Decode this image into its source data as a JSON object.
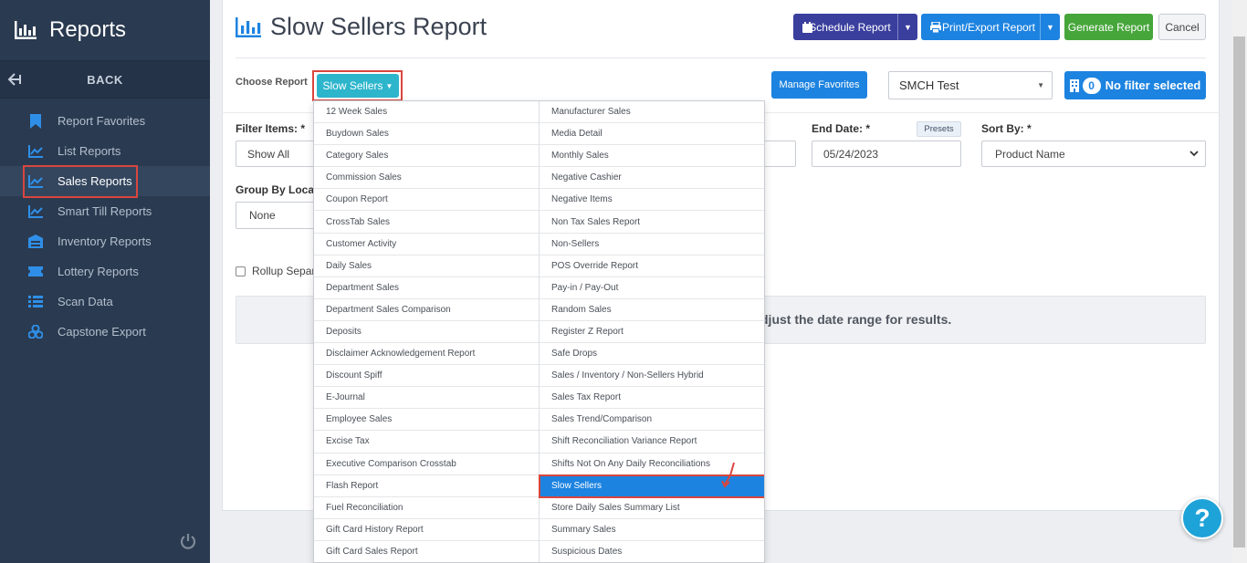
{
  "sidebar": {
    "title": "Reports",
    "back": "BACK",
    "items": [
      {
        "label": "Report Favorites",
        "icon": "bookmark-icon"
      },
      {
        "label": "List Reports",
        "icon": "line-chart-icon"
      },
      {
        "label": "Sales Reports",
        "icon": "line-chart-icon",
        "active": true
      },
      {
        "label": "Smart Till Reports",
        "icon": "line-chart-icon"
      },
      {
        "label": "Inventory Reports",
        "icon": "warehouse-icon"
      },
      {
        "label": "Lottery Reports",
        "icon": "ticket-icon"
      },
      {
        "label": "Scan Data",
        "icon": "list-icon"
      },
      {
        "label": "Capstone Export",
        "icon": "cubes-icon"
      }
    ]
  },
  "header": {
    "title": "Slow Sellers Report",
    "schedule_label": "Schedule Report",
    "print_label": "Print/Export Report",
    "generate_label": "Generate Report",
    "cancel_label": "Cancel"
  },
  "controls": {
    "choose_label": "Choose Report",
    "report_button": "Slow Sellers",
    "favorites_label": "Manage Favorites",
    "store": "SMCH Test",
    "filter_count": "0",
    "filter_label": "No filter selected"
  },
  "form": {
    "filter_items_label": "Filter Items: *",
    "filter_items_value": "Show All",
    "end_date_label": "End Date: *",
    "presets_label": "Presets",
    "end_date_value": "05/24/2023",
    "sort_by_label": "Sort By: *",
    "sort_by_value": "Product Name",
    "group_by_label": "Group By Locatio",
    "group_by_value": "None",
    "rollup_label": "Rollup Separa",
    "message": "djust the date range for results."
  },
  "menu": {
    "left": [
      "12 Week Sales",
      "Buydown Sales",
      "Category Sales",
      "Commission Sales",
      "Coupon Report",
      "CrossTab Sales",
      "Customer Activity",
      "Daily Sales",
      "Department Sales",
      "Department Sales Comparison",
      "Deposits",
      "Disclaimer Acknowledgement Report",
      "Discount Spiff",
      "E-Journal",
      "Employee Sales",
      "Excise Tax",
      "Executive Comparison Crosstab",
      "Flash Report",
      "Fuel Reconciliation",
      "Gift Card History Report",
      "Gift Card Sales Report"
    ],
    "right": [
      "Manufacturer Sales",
      "Media Detail",
      "Monthly Sales",
      "Negative Cashier",
      "Negative Items",
      "Non Tax Sales Report",
      "Non-Sellers",
      "POS Override Report",
      "Pay-in / Pay-Out",
      "Random Sales",
      "Register Z Report",
      "Safe Drops",
      "Sales / Inventory / Non-Sellers Hybrid",
      "Sales Tax Report",
      "Sales Trend/Comparison",
      "Shift Reconciliation Variance Report",
      "Shifts Not On Any Daily Reconciliations",
      "Slow Sellers",
      "Store Daily Sales Summary List",
      "Summary Sales",
      "Suspicious Dates"
    ],
    "selected": "Slow Sellers"
  },
  "help_label": "?",
  "colors": {
    "sidebar_bg": "#2a3a50",
    "accent_blue": "#1d83e0",
    "teal": "#2db5cc",
    "green": "#46a63a",
    "indigo": "#3a3f9e",
    "highlight_red": "#d9463e"
  }
}
